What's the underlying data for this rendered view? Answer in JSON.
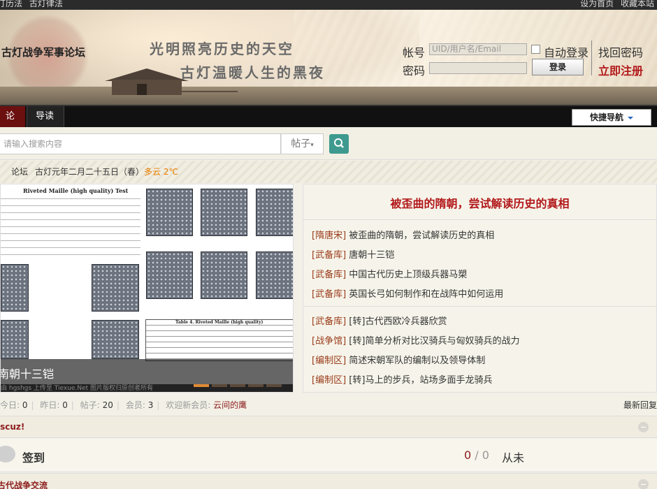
{
  "topbar": {
    "left_links": [
      "汀历法",
      "古灯律法"
    ],
    "right_links": [
      "设为首页",
      "收藏本站"
    ]
  },
  "header": {
    "site_name": "古灯战争军事论坛",
    "slogan_line1": "光明照亮历史的天空",
    "slogan_line2": "古灯温暖人生的黑夜"
  },
  "login": {
    "account_label": "帐号",
    "account_placeholder": "UID/用户名/Email",
    "password_label": "密码",
    "auto_login_label": "自动登录",
    "login_button": "登录",
    "forgot_password": "找回密码",
    "register": "立即注册"
  },
  "nav": {
    "items": [
      "论坛",
      "导读"
    ],
    "quick_nav": "快捷导航"
  },
  "search": {
    "placeholder": "请输入搜索内容",
    "type": "帖子"
  },
  "breadcrumb": {
    "home": "〉",
    "forum": "论坛",
    "date": "古灯元年二月二十五日（春）",
    "weather": "多云 2℃"
  },
  "slideshow": {
    "paper_title": "Riveted Maille (high quality) Test",
    "table_title": "Table 4. Riveted Maille (high quality)",
    "caption": "南朝十三铠",
    "footer": "由 hgshgs 上传至 Tiexue.Net 图片版权归原创者所有",
    "active_index": 0,
    "count": 5
  },
  "featured": {
    "title": "被歪曲的隋朝，尝试解读历史的真相",
    "items": [
      {
        "category": "[隋唐宋]",
        "title": "被歪曲的隋朝，尝试解读历史的真相"
      },
      {
        "category": "[武备库]",
        "title": "唐朝十三铠"
      },
      {
        "category": "[武备库]",
        "title": "中国古代历史上顶级兵器马槊"
      },
      {
        "category": "[武备库]",
        "title": "英国长弓如何制作和在战阵中如何运用"
      },
      {
        "category": "[武备库]",
        "title": "[转]古代西欧冷兵器欣赏"
      },
      {
        "category": "[战争馆]",
        "title": "[转]简单分析对比汉骑兵与匈奴骑兵的战力"
      },
      {
        "category": "[编制区]",
        "title": "简述宋朝军队的编制以及领导体制"
      },
      {
        "category": "[编制区]",
        "title": "[转]马上的步兵，站场多面手龙骑兵"
      }
    ]
  },
  "stats": {
    "today_label": "今日:",
    "today": "0",
    "yesterday_label": "昨日:",
    "yesterday": "0",
    "posts_label": "帖子:",
    "posts": "20",
    "members_label": "会员:",
    "members": "3",
    "welcome": "欢迎新会员:",
    "newest_member": "云间的鹰",
    "latest_reply": "最新回复"
  },
  "categories": [
    {
      "title": "iscuz!"
    },
    {
      "title": "古代战争交流"
    }
  ],
  "signin": {
    "title": "签到",
    "count": "0",
    "slash": "/",
    "total": "0",
    "status": "从未"
  }
}
